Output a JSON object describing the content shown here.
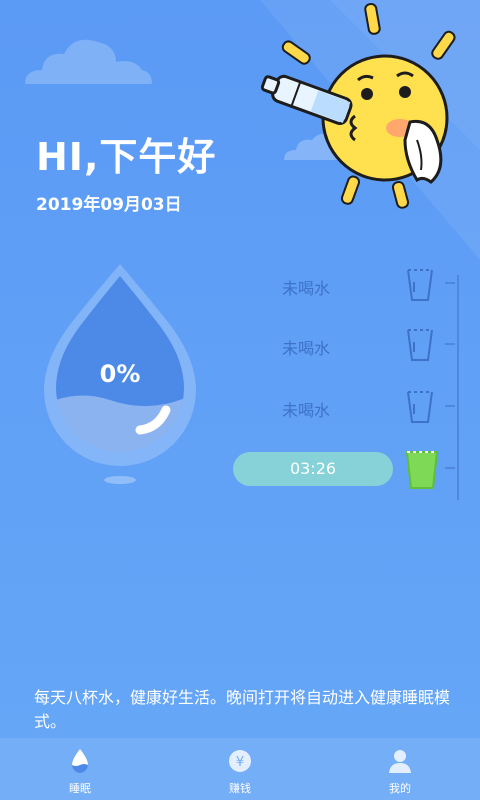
{
  "header": {
    "greeting": "HI,下午好",
    "date": "2019年09月03日"
  },
  "drop": {
    "percent": "0%"
  },
  "cups": [
    {
      "label": "未喝水",
      "state": "empty"
    },
    {
      "label": "未喝水",
      "state": "empty"
    },
    {
      "label": "未喝水",
      "state": "empty"
    },
    {
      "label": "03:26",
      "state": "full"
    }
  ],
  "tip": "每天八杯水，健康好生活。晚间打开将自动进入健康睡眠模式。",
  "nav": {
    "items": [
      {
        "label": "睡眠",
        "icon": "drop-icon"
      },
      {
        "label": "赚钱",
        "icon": "yen-coin-icon"
      },
      {
        "label": "我的",
        "icon": "person-icon"
      }
    ]
  },
  "colors": {
    "background": "#5b9af5",
    "accent": "#7ed957",
    "pill": "#86d2d8"
  }
}
